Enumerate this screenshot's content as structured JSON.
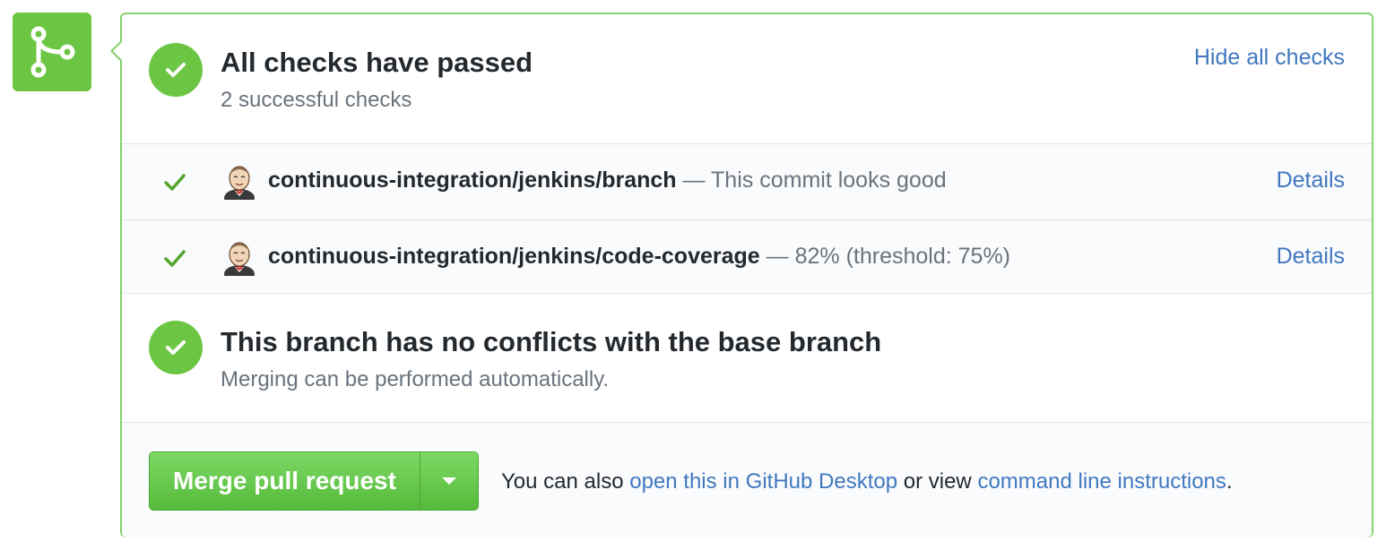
{
  "summary": {
    "title": "All checks have passed",
    "subtitle": "2 successful checks",
    "toggle_link": "Hide all checks"
  },
  "checks": [
    {
      "context": "continuous-integration/jenkins/branch",
      "description": "— This commit looks good",
      "details_label": "Details"
    },
    {
      "context": "continuous-integration/jenkins/code-coverage",
      "description": "— 82% (threshold: 75%)",
      "details_label": "Details"
    }
  ],
  "branch_status": {
    "title": "This branch has no conflicts with the base branch",
    "subtitle": "Merging can be performed automatically."
  },
  "merge": {
    "button_label": "Merge pull request",
    "note_prefix": "You can also",
    "desktop_link": "open this in GitHub Desktop",
    "note_middle": "or view",
    "cli_link": "command line instructions",
    "note_suffix": "."
  },
  "colors": {
    "success_green": "#6cc644",
    "link_blue": "#4078c0",
    "panel_border": "#86d26b"
  },
  "icons": {
    "status": "git-merge-icon",
    "check": "check-icon",
    "avatar": "jenkins-avatar-icon",
    "dropdown": "caret-down-icon"
  }
}
